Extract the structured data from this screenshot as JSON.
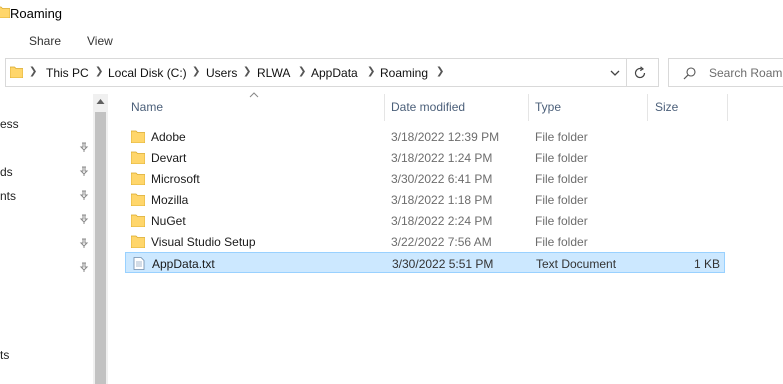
{
  "window": {
    "title": "Roaming"
  },
  "ribbon": {
    "tabs": [
      "Share",
      "View"
    ]
  },
  "address": {
    "crumbs": [
      "This PC",
      "Local Disk (C:)",
      "Users",
      "RLWA",
      "AppData",
      "Roaming"
    ]
  },
  "search": {
    "placeholder": "Search Roaming"
  },
  "nav": {
    "items": [
      {
        "label": "ess",
        "pinned": false
      },
      {
        "label": "",
        "pinned": true
      },
      {
        "label": "ds",
        "pinned": true
      },
      {
        "label": "nts",
        "pinned": true
      },
      {
        "label": "",
        "pinned": true
      },
      {
        "label": "",
        "pinned": true
      },
      {
        "label": "",
        "pinned": true
      },
      {
        "label": "ts",
        "pinned": false
      }
    ]
  },
  "columns": {
    "name": "Name",
    "date": "Date modified",
    "type": "Type",
    "size": "Size"
  },
  "files": [
    {
      "name": "Adobe",
      "date": "3/18/2022 12:39 PM",
      "type": "File folder",
      "size": "",
      "icon": "folder-icon",
      "selected": false
    },
    {
      "name": "Devart",
      "date": "3/18/2022 1:24 PM",
      "type": "File folder",
      "size": "",
      "icon": "folder-icon",
      "selected": false
    },
    {
      "name": "Microsoft",
      "date": "3/30/2022 6:41 PM",
      "type": "File folder",
      "size": "",
      "icon": "folder-icon",
      "selected": false
    },
    {
      "name": "Mozilla",
      "date": "3/18/2022 1:18 PM",
      "type": "File folder",
      "size": "",
      "icon": "folder-icon",
      "selected": false
    },
    {
      "name": "NuGet",
      "date": "3/18/2022 2:24 PM",
      "type": "File folder",
      "size": "",
      "icon": "folder-icon",
      "selected": false
    },
    {
      "name": "Visual Studio Setup",
      "date": "3/22/2022 7:56 AM",
      "type": "File folder",
      "size": "",
      "icon": "folder-icon",
      "selected": false
    },
    {
      "name": "AppData.txt",
      "date": "3/30/2022 5:51 PM",
      "type": "Text Document",
      "size": "1 KB",
      "icon": "text-file-icon",
      "selected": true
    }
  ],
  "colors": {
    "selection_bg": "#cce8ff",
    "selection_border": "#99d1ff",
    "folder": "#ffd66b",
    "header_text": "#4c607a"
  }
}
